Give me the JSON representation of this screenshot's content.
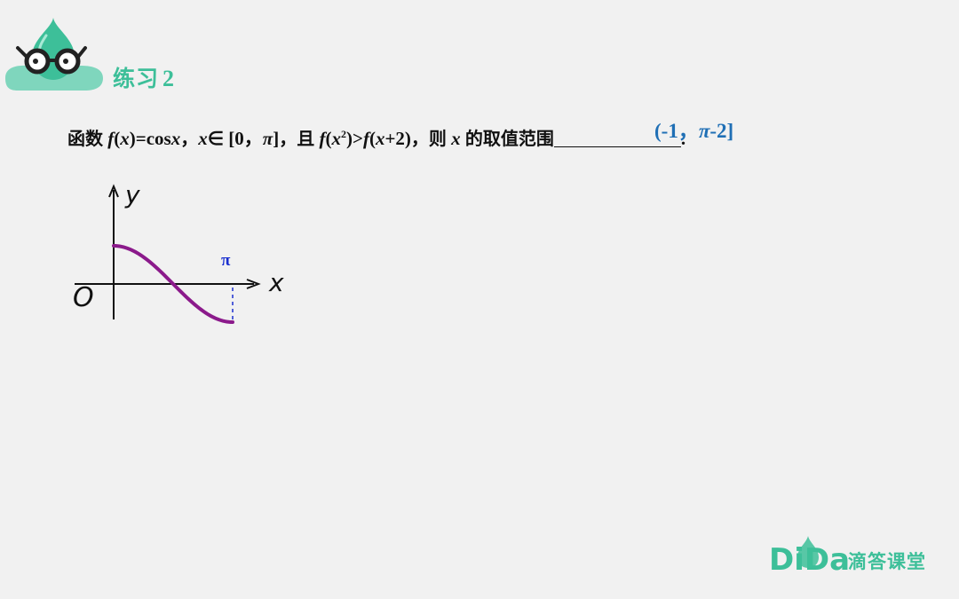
{
  "header": {
    "title": "练习",
    "number": "2"
  },
  "problem": {
    "p1": "函数",
    "f1": "f",
    "p2": "(",
    "x1": "x",
    "p3": ")=cos",
    "x2": "x",
    "p4": "，",
    "x3": "x",
    "p5": "∈ [0，",
    "pi1": "π",
    "p6": "]",
    "p7": "，且",
    "f2": "f",
    "p8": "(",
    "x4": "x",
    "sup2": "2",
    "p9": ")>",
    "f3": "f",
    "p10": "(",
    "x5": "x",
    "p11": "+2)",
    "p12": "，则",
    "x6": "x",
    "p13": "的取值范围",
    "end": "."
  },
  "answer": {
    "a1": "(-1，",
    "pi": "π",
    "a2": "-2]"
  },
  "graph": {
    "y_label": "y",
    "x_label": "x",
    "origin_label": "O",
    "pi_label": "π",
    "curve_color": "#8b1a8b"
  },
  "brand": {
    "logo_text": "DiDa",
    "name": "滴答课堂"
  },
  "colors": {
    "accent": "#3dbf99",
    "answer": "#1f6fb5",
    "pi_mark": "#1a2fcf"
  }
}
